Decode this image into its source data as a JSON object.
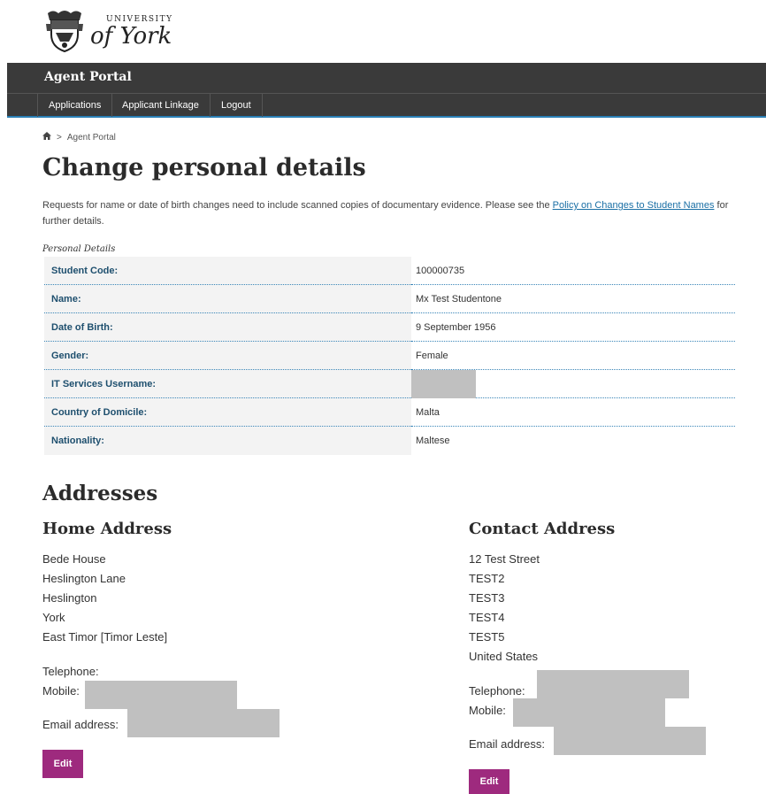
{
  "logo": {
    "small": "UNIVERSITY",
    "big": "of York"
  },
  "portal": {
    "title": "Agent Portal"
  },
  "nav": {
    "items": [
      "Applications",
      "Applicant Linkage",
      "Logout"
    ]
  },
  "breadcrumb": {
    "separator": ">",
    "current": "Agent Portal"
  },
  "page": {
    "title": "Change personal details",
    "intro_text": "Requests for name or date of birth changes need to include scanned copies of documentary evidence. Please see the ",
    "intro_link": "Policy on Changes to Student Names",
    "intro_suffix": " for further details.",
    "details_caption": "Personal Details"
  },
  "details": [
    {
      "label": "Student Code:",
      "value": "100000735"
    },
    {
      "label": "Name:",
      "value": "Mx Test Studentone"
    },
    {
      "label": "Date of Birth:",
      "value": "9 September 1956"
    },
    {
      "label": "Gender:",
      "value": "Female"
    },
    {
      "label": "IT Services Username:",
      "value": ""
    },
    {
      "label": "Country of Domicile:",
      "value": "Malta"
    },
    {
      "label": "Nationality:",
      "value": "Maltese"
    }
  ],
  "addresses": {
    "heading": "Addresses",
    "home": {
      "heading": "Home Address",
      "lines": [
        "Bede House",
        "Heslington Lane",
        "Heslington",
        "York",
        "East Timor [Timor Leste]"
      ],
      "telephone_label": "Telephone:",
      "mobile_label": "Mobile:",
      "email_label": "Email address:",
      "edit_label": "Edit"
    },
    "contact": {
      "heading": "Contact Address",
      "lines": [
        "12 Test Street",
        "TEST2",
        "TEST3",
        "TEST4",
        "TEST5",
        "United States"
      ],
      "telephone_label": "Telephone:",
      "mobile_label": "Mobile:",
      "email_label": "Email address:",
      "edit_label": "Edit"
    }
  },
  "colors": {
    "nav_bg": "#3a3a3a",
    "nav_accent": "#2a7fb5",
    "label_text": "#1e4f6e",
    "button": "#9e2a7e"
  },
  "icons": {
    "home": "home-icon",
    "crest": "york-crest-icon"
  }
}
